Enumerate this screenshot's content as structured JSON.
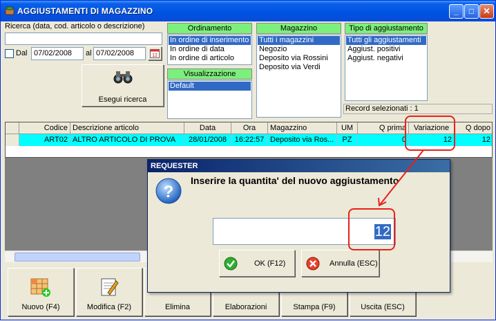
{
  "window": {
    "title": "AGGIUSTAMENTI DI MAGAZZINO",
    "minimize": "_",
    "maximize": "□",
    "close": "✕"
  },
  "search": {
    "label": "Ricerca (data, cod. articolo o descrizione)",
    "value": "",
    "dal_label": "Dal",
    "dal_checked": false,
    "date_from": "07/02/2008",
    "al_label": "al",
    "date_to": "07/02/2008",
    "execute_label": "Esegui ricerca"
  },
  "ordinamento": {
    "header": "Ordinamento",
    "items": [
      "In ordine di inserimento",
      "In ordine di data",
      "In ordine di articolo"
    ],
    "selected": 0
  },
  "visualizzazione": {
    "header": "Visualizzazione",
    "items": [
      "Default"
    ],
    "selected": 0
  },
  "magazzino": {
    "header": "Magazzino",
    "items": [
      "Tutti i magazzini",
      "Negozio",
      "Deposito via Rossini",
      "Deposito via Verdi"
    ],
    "selected": 0
  },
  "tipo": {
    "header": "Tipo di aggiustamento",
    "items": [
      "Tutti gli aggiustamenti",
      "Aggiust. positivi",
      "Aggiust. negativi"
    ],
    "selected": 0
  },
  "record_selezionati": "Record selezionati : 1",
  "grid": {
    "columns": [
      "Codice",
      "Descrizione articolo",
      "Data",
      "Ora",
      "Magazzino",
      "UM",
      "Q prima",
      "Variazione",
      "Q dopo"
    ],
    "rows": [
      [
        "ART02",
        "ALTRO ARTICOLO DI PROVA",
        "28/01/2008",
        "16:22:57",
        "Deposito via Ros...",
        "PZ",
        "0",
        "12",
        "12"
      ]
    ]
  },
  "toolbar": {
    "buttons": [
      "Nuovo (F4)",
      "Modifica (F2)",
      "Elimina",
      "Elaborazioni",
      "Stampa (F9)",
      "Uscita (ESC)"
    ]
  },
  "dialog": {
    "title": "REQUESTER",
    "message": "Inserire la quantita' del nuovo aggiustamento",
    "value": "12",
    "ok_label": "OK (F12)",
    "cancel_label": "Annulla (ESC)"
  },
  "colors": {
    "title_bar": "#0053e1",
    "panel_header": "#7cf07c",
    "selected_row": "#00ffff",
    "selection": "#316ac5",
    "annotation": "#e8201b"
  }
}
